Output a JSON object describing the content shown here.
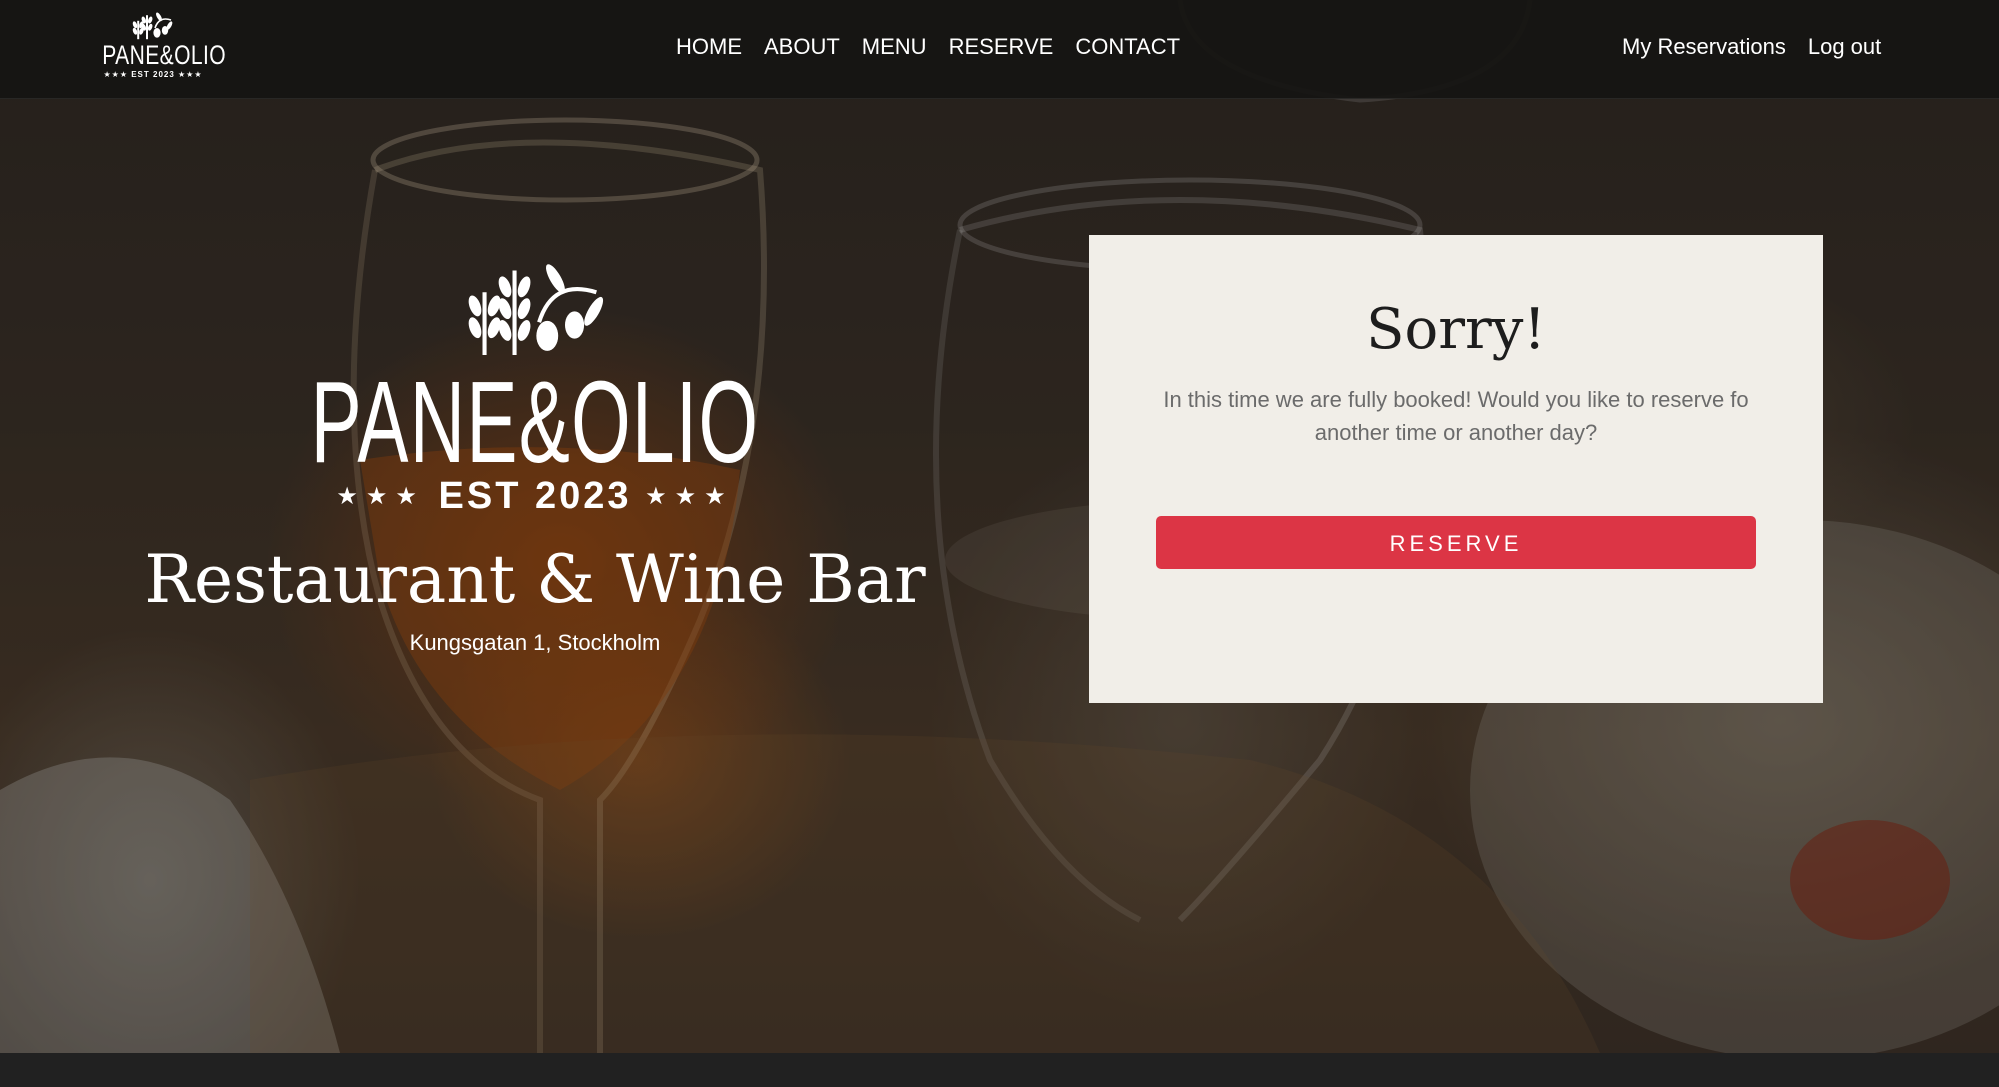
{
  "navbar": {
    "logo": {
      "word": "PANE&OLIO",
      "est": "★★★ EST 2023 ★★★"
    },
    "links": [
      "HOME",
      "ABOUT",
      "MENU",
      "RESERVE",
      "CONTACT"
    ],
    "account": {
      "reservations": "My Reservations",
      "logout": "Log out"
    }
  },
  "hero": {
    "brand": {
      "word": "PANE&OLIO",
      "est": "EST 2023",
      "stars_left": "★★★",
      "stars_right": "★★★"
    },
    "tagline": "Restaurant & Wine Bar",
    "address": "Kungsgatan 1, Stockholm"
  },
  "card": {
    "title": "Sorry!",
    "message": "In this time we are fully booked! Would you like to reserve fo another time or another day?",
    "button": "RESERVE"
  },
  "colors": {
    "accent": "#dc3545",
    "card_bg": "#f1eee8",
    "navbar_bg": "#161412",
    "footer_bg": "#212121"
  },
  "icons": [
    "olive-branch-logo-icon"
  ]
}
